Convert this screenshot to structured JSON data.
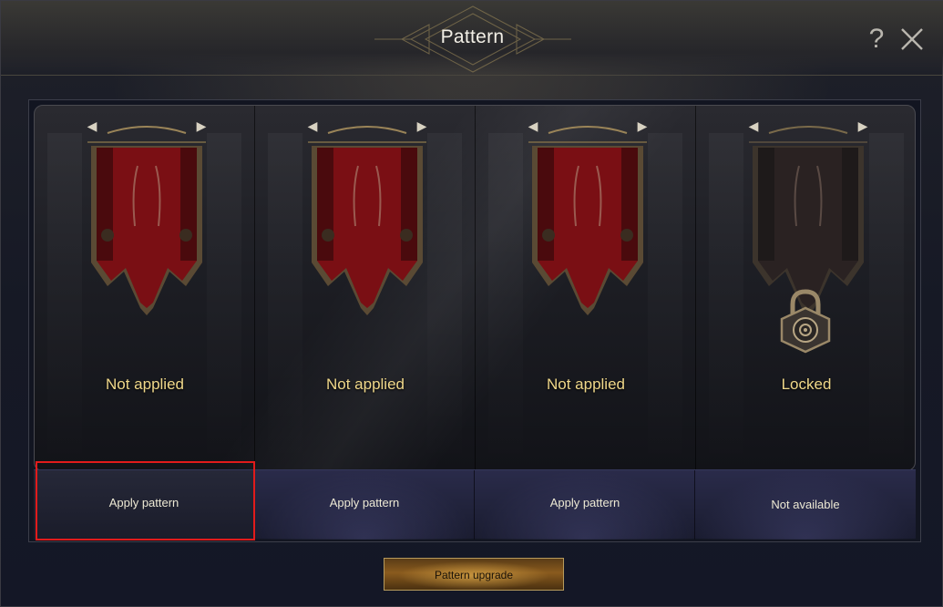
{
  "window": {
    "title": "Pattern"
  },
  "header": {
    "help_label": "?"
  },
  "slots": [
    {
      "status": "Not applied",
      "button": "Apply pattern",
      "locked": false
    },
    {
      "status": "Not applied",
      "button": "Apply pattern",
      "locked": false
    },
    {
      "status": "Not applied",
      "button": "Apply pattern",
      "locked": false
    },
    {
      "status": "Locked",
      "button": "Not available",
      "locked": true
    }
  ],
  "footer": {
    "upgrade_label": "Pattern upgrade"
  },
  "colors": {
    "accent_gold": "#f0d88a",
    "banner_red": "#7a0f14",
    "highlight": "#e11b1b"
  }
}
